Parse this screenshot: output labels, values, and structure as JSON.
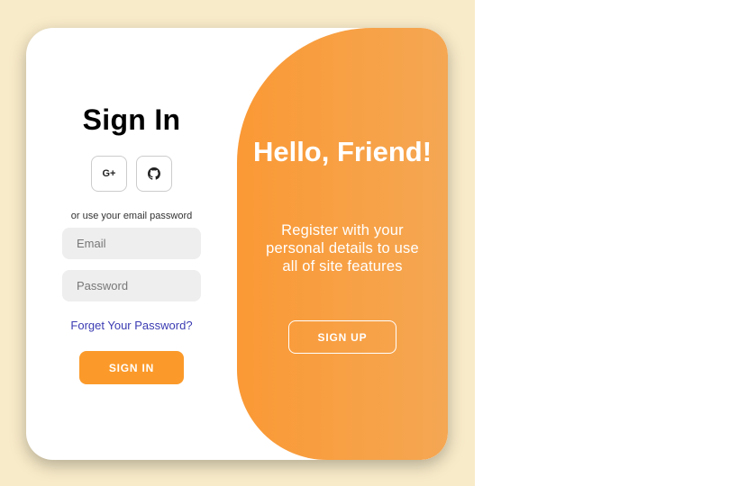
{
  "signin": {
    "title": "Sign In",
    "social": [
      {
        "icon": "google-plus-icon",
        "glyph": "G+"
      },
      {
        "icon": "github-icon"
      }
    ],
    "hint": "or use your email password",
    "email_placeholder": "Email",
    "password_placeholder": "Password",
    "forgot_label": "Forget Your Password?",
    "button_label": "SIGN IN"
  },
  "panel": {
    "greeting": "Hello, Friend!",
    "text": "Register with your personal details to use all of site features",
    "button_label": "SIGN UP"
  },
  "colors": {
    "backdrop": "#f8ebc9",
    "accent": "#fb9a2a",
    "panel_gradient_start": "#fa9935",
    "panel_gradient_end": "#f5a753",
    "link": "#3b3bb3",
    "field_bg": "#eeeeee"
  }
}
